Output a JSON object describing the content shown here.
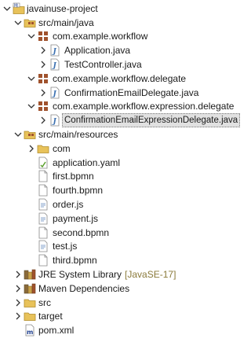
{
  "project": {
    "name": "javainuse-project",
    "badge": "M"
  },
  "nodes": [
    {
      "label": "javainuse-project",
      "expanded": true
    },
    {
      "label": "src/main/java",
      "expanded": true
    },
    {
      "label": "com.example.workflow",
      "expanded": true
    },
    {
      "label": "Application.java",
      "expanded": false
    },
    {
      "label": "TestController.java",
      "expanded": false
    },
    {
      "label": "com.example.workflow.delegate",
      "expanded": true
    },
    {
      "label": "ConfirmationEmailDelegate.java",
      "expanded": false
    },
    {
      "label": "com.example.workflow.expression.delegate",
      "expanded": true
    },
    {
      "label": "ConfirmationEmailExpressionDelegate.java",
      "expanded": false,
      "selected": true
    },
    {
      "label": "src/main/resources",
      "expanded": true
    },
    {
      "label": "com",
      "expanded": false
    },
    {
      "label": "application.yaml"
    },
    {
      "label": "first.bpmn"
    },
    {
      "label": "fourth.bpmn"
    },
    {
      "label": "order.js"
    },
    {
      "label": "payment.js"
    },
    {
      "label": "second.bpmn"
    },
    {
      "label": "test.js"
    },
    {
      "label": "third.bpmn"
    },
    {
      "label": "JRE System Library",
      "decoration": "[JavaSE-17]",
      "expanded": false
    },
    {
      "label": "Maven Dependencies",
      "expanded": false
    },
    {
      "label": "src",
      "expanded": false
    },
    {
      "label": "target",
      "expanded": false
    },
    {
      "label": "pom.xml"
    }
  ],
  "colors": {
    "folder": "#e8c25a",
    "package": "#a0522d",
    "java_blue": "#3a6fb0",
    "selection_bg": "#e1e1e1",
    "decoration": "#8a7a3a"
  }
}
